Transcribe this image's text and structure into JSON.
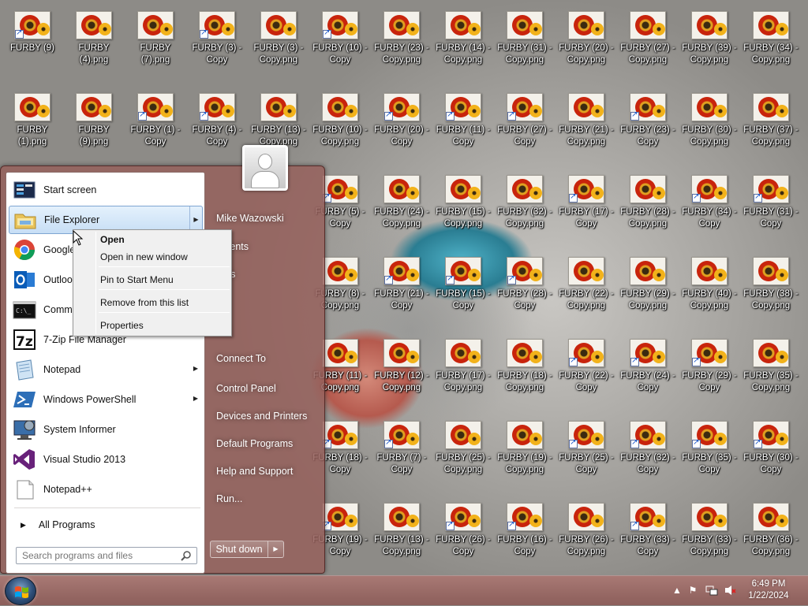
{
  "desktop": {
    "row1": [
      "FURBY (9)",
      "FURBY\n(4).png",
      "FURBY\n(7).png",
      "FURBY (3) -\nCopy",
      "FURBY (3) -\nCopy.png",
      "FURBY (10) -\nCopy",
      "FURBY (23) -\nCopy.png",
      "FURBY (14) -\nCopy.png",
      "FURBY (31) -\nCopy.png",
      "FURBY (20) -\nCopy.png",
      "FURBY (27) -\nCopy.png",
      "FURBY (39) -\nCopy.png",
      "FURBY (34) -\nCopy.png"
    ],
    "row2": [
      "FURBY\n(1).png",
      "FURBY\n(9).png",
      "FURBY (1) -\nCopy",
      "FURBY (4) -\nCopy",
      "FURBY (13) -\nCopy.png",
      "FURBY (10) -\nCopy.png",
      "FURBY (20) -\nCopy",
      "FURBY (11) -\nCopy",
      "FURBY (27) -\nCopy",
      "FURBY (21) -\nCopy.png",
      "FURBY (23) -\nCopy",
      "FURBY (30) -\nCopy.png",
      "FURBY (37) -\nCopy.png"
    ],
    "row3": [
      "FURBY (5) -\nCopy",
      "FURBY (24) -\nCopy.png",
      "FURBY (15) -\nCopy.png",
      "FURBY (32) -\nCopy.png",
      "FURBY (17) -\nCopy",
      "FURBY (28) -\nCopy.png",
      "FURBY (34) -\nCopy",
      "FURBY (31) -\nCopy"
    ],
    "row4": [
      "FURBY (8) -\nCopy.png",
      "FURBY (21) -\nCopy",
      "FURBY (15) -\nCopy",
      "FURBY (28) -\nCopy",
      "FURBY (22) -\nCopy.png",
      "FURBY (29) -\nCopy.png",
      "FURBY (40) -\nCopy.png",
      "FURBY (38) -\nCopy.png"
    ],
    "row5": [
      "FURBY (11) -\nCopy.png",
      "FURBY (12) -\nCopy.png",
      "FURBY (17) -\nCopy.png",
      "FURBY (18) -\nCopy.png",
      "FURBY (22) -\nCopy",
      "FURBY (24) -\nCopy",
      "FURBY (29) -\nCopy",
      "FURBY (35) -\nCopy.png"
    ],
    "row6": [
      "FURBY (18) -\nCopy",
      "FURBY (7) -\nCopy",
      "FURBY (25) -\nCopy.png",
      "FURBY (19) -\nCopy.png",
      "FURBY (25) -\nCopy",
      "FURBY (32) -\nCopy",
      "FURBY (35) -\nCopy",
      "FURBY (30) -\nCopy"
    ],
    "row7": [
      "FURBY (19) -\nCopy",
      "FURBY (13) -\nCopy.png",
      "FURBY (26) -\nCopy",
      "FURBY (16) -\nCopy",
      "FURBY (26) -\nCopy.png",
      "FURBY (33) -\nCopy",
      "FURBY (33) -\nCopy.png",
      "FURBY (36) -\nCopy.png"
    ]
  },
  "start_menu": {
    "programs": [
      {
        "label": "Start screen",
        "icon": "start-screen-icon"
      },
      {
        "label": "File Explorer",
        "icon": "folder-icon"
      },
      {
        "label": "Google",
        "icon": "chrome-icon"
      },
      {
        "label": "Outlook",
        "icon": "outlook-icon"
      },
      {
        "label": "Comma",
        "icon": "command-prompt-icon"
      },
      {
        "label": "7-Zip File Manager",
        "icon": "7zip-icon"
      },
      {
        "label": "Notepad",
        "icon": "notepad-icon"
      },
      {
        "label": "Windows PowerShell",
        "icon": "powershell-icon"
      },
      {
        "label": "System Informer",
        "icon": "system-informer-icon"
      },
      {
        "label": "Visual Studio 2013",
        "icon": "visual-studio-icon"
      },
      {
        "label": "Notepad++",
        "icon": "notepadpp-icon"
      }
    ],
    "all_programs": "All Programs",
    "search_placeholder": "Search programs and files",
    "right": {
      "user": "Mike Wazowski",
      "items": [
        "uments",
        "ures",
        "sic",
        "PC",
        "Connect To",
        "Control Panel",
        "Devices and Printers",
        "Default Programs",
        "Help and Support",
        "Run..."
      ]
    },
    "shutdown": "Shut down"
  },
  "context_menu": {
    "items": [
      "Open",
      "Open in new window",
      "Pin to Start Menu",
      "Remove from this list",
      "Properties"
    ]
  },
  "taskbar": {
    "time": "6:49 PM",
    "date": "1/22/2024"
  },
  "colors": {
    "menu_frame": "#965f5a",
    "hover_blue": "#c7def5"
  }
}
